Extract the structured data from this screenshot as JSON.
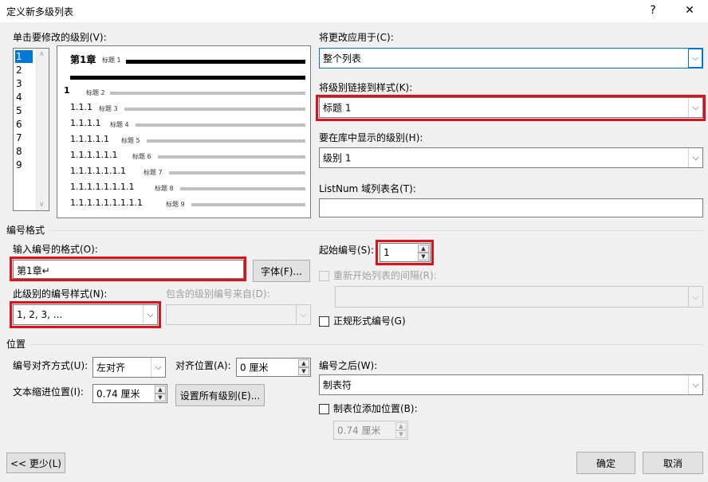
{
  "window": {
    "title": "定义新多级列表",
    "help": "?",
    "close": "✕"
  },
  "levels": {
    "label": "单击要修改的级别(V):",
    "items": [
      "1",
      "2",
      "3",
      "4",
      "5",
      "6",
      "7",
      "8",
      "9"
    ],
    "selected": "1"
  },
  "preview": {
    "chapter_num": "第1章",
    "rows": [
      {
        "num": "第1章",
        "style": "标题 1"
      },
      {
        "num": "1",
        "style": "标题 2"
      },
      {
        "num": "1.1.1",
        "style": "标题 3"
      },
      {
        "num": "1.1.1.1",
        "style": "标题 4"
      },
      {
        "num": "1.1.1.1.1",
        "style": "标题 5"
      },
      {
        "num": "1.1.1.1.1.1",
        "style": "标题 6"
      },
      {
        "num": "1.1.1.1.1.1.1",
        "style": "标题 7"
      },
      {
        "num": "1.1.1.1.1.1.1.1",
        "style": "标题 8"
      },
      {
        "num": "1.1.1.1.1.1.1.1.1",
        "style": "标题 9"
      }
    ]
  },
  "apply_to": {
    "label": "将更改应用于(C):",
    "value": "整个列表"
  },
  "link_style": {
    "label": "将级别链接到样式(K):",
    "value": "标题 1"
  },
  "gallery_level": {
    "label": "要在库中显示的级别(H):",
    "value": "级别 1"
  },
  "listnum": {
    "label": "ListNum 域列表名(T):",
    "value": ""
  },
  "numbering_format": {
    "section": "编号格式",
    "format_label": "输入编号的格式(O):",
    "format_value": "第1章↵",
    "font_button": "字体(F)...",
    "style_label": "此级别的编号样式(N):",
    "style_value": "1, 2, 3, ...",
    "include_label": "包含的级别编号来自(D):",
    "include_value": "",
    "start_label": "起始编号(S):",
    "start_value": "1",
    "restart_label": "重新开始列表的间隔(R):",
    "restart_value": "",
    "legal_label": "正规形式编号(G)"
  },
  "position": {
    "section": "位置",
    "align_label": "编号对齐方式(U):",
    "align_value": "左对齐",
    "at_label": "对齐位置(A):",
    "at_value": "0 厘米",
    "indent_label": "文本缩进位置(I):",
    "indent_value": "0.74 厘米",
    "set_all_button": "设置所有级别(E)...",
    "follow_label": "编号之后(W):",
    "follow_value": "制表符",
    "tab_label": "制表位添加位置(B):",
    "tab_value": "0.74 厘米"
  },
  "footer": {
    "less": "<< 更少(L)",
    "ok": "确定",
    "cancel": "取消"
  },
  "colors": {
    "highlight": "#e0101a",
    "selection": "#0078d7"
  }
}
